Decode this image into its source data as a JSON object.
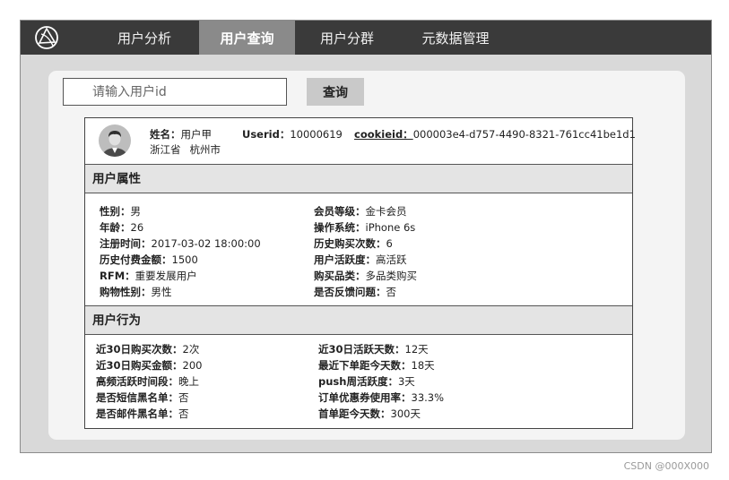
{
  "nav": {
    "items": [
      {
        "label": "用户分析",
        "active": false
      },
      {
        "label": "用户查询",
        "active": true
      },
      {
        "label": "用户分群",
        "active": false
      },
      {
        "label": "元数据管理",
        "active": false
      }
    ]
  },
  "search": {
    "placeholder": "请输入用户id",
    "button_label": "查询"
  },
  "profile": {
    "name_label": "姓名：",
    "name": "用户甲",
    "userid_label": "Userid：",
    "userid": "10000619",
    "cookieid_label": "cookieid：",
    "cookieid": "000003e4-d757-4490-8321-761cc41be1d1",
    "province": "浙江省",
    "city": "杭州市"
  },
  "attributes": {
    "title": "用户属性",
    "left": [
      {
        "label": "性别：",
        "value": "男"
      },
      {
        "label": "年龄：",
        "value": "26"
      },
      {
        "label": "注册时间：",
        "value": "2017-03-02 18:00:00"
      },
      {
        "label": "历史付费金额：",
        "value": "1500"
      },
      {
        "label": "RFM：",
        "value": "重要发展用户"
      },
      {
        "label": "购物性别：",
        "value": "男性"
      }
    ],
    "right": [
      {
        "label": "会员等级：",
        "value": "金卡会员"
      },
      {
        "label": "操作系统：",
        "value": "iPhone 6s"
      },
      {
        "label": "历史购买次数：",
        "value": "6"
      },
      {
        "label": "用户活跃度：",
        "value": "高活跃"
      },
      {
        "label": "购买品类：",
        "value": "多品类购买"
      },
      {
        "label": "是否反馈问题：",
        "value": "否"
      }
    ]
  },
  "behavior": {
    "title": "用户行为",
    "left": [
      {
        "label": "近30日购买次数：",
        "value": "2次"
      },
      {
        "label": "近30日购买金额：",
        "value": "200"
      },
      {
        "label": "高频活跃时间段：",
        "value": "晚上"
      },
      {
        "label": "是否短信黑名单：",
        "value": "否"
      },
      {
        "label": "是否邮件黑名单：",
        "value": "否"
      }
    ],
    "right": [
      {
        "label": "近30日活跃天数：",
        "value": "12天"
      },
      {
        "label": "最近下单距今天数：",
        "value": "18天"
      },
      {
        "label": "push周活跃度：",
        "value": "3天"
      },
      {
        "label": "订单优惠券使用率：",
        "value": "33.3%"
      },
      {
        "label": "首单距今天数：",
        "value": "300天"
      }
    ]
  },
  "watermark": "CSDN @000X000",
  "colors": {
    "navbar": "#3a3a3a",
    "active_tab": "#8a8a8a",
    "section_header": "#e4e4e4"
  },
  "icons": {
    "logo": "globe-logo-icon",
    "avatar": "user-avatar-icon"
  }
}
